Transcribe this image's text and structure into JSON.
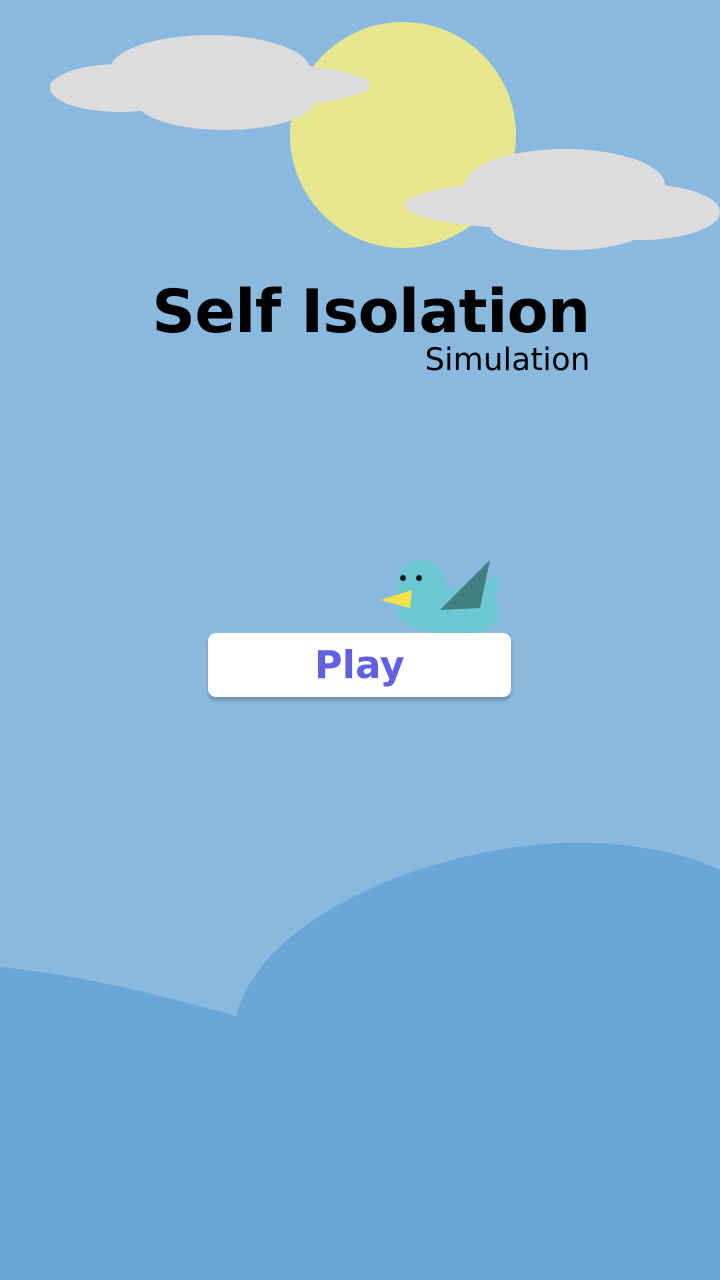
{
  "title": {
    "main": "Self Isolation",
    "sub": "Simulation"
  },
  "menu": {
    "play_label": "Play"
  },
  "colors": {
    "sky": "#8ab9df",
    "hill": "#6aa7d8",
    "sun": "#e6e68e",
    "cloud": "#dcdcdc",
    "bird_body": "#6bc8d1",
    "bird_wing": "#3f7f7f",
    "bird_beak": "#f2e24a",
    "play_text": "#6060e0"
  },
  "icons": {
    "sun": "sun-icon",
    "cloud": "cloud-icon",
    "bird": "bird-icon"
  }
}
